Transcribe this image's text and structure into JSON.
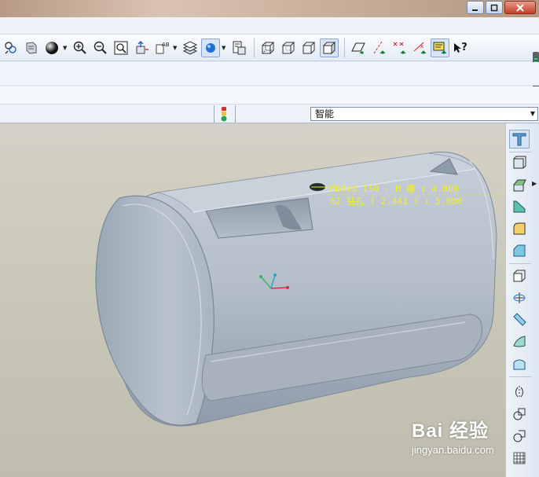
{
  "window": {
    "controls": [
      "minimize",
      "restore",
      "close"
    ]
  },
  "toolbar": {
    "buttons": [
      {
        "name": "layer-icon"
      },
      {
        "name": "saved-view-icon"
      },
      {
        "name": "sphere-shading-icon"
      },
      {
        "name": "zoom-in-icon"
      },
      {
        "name": "zoom-out-icon"
      },
      {
        "name": "refit-icon"
      },
      {
        "name": "reorient-icon"
      },
      {
        "name": "named-views-icon"
      },
      {
        "name": "layers-icon"
      },
      {
        "name": "appearance-icon",
        "active": true
      },
      {
        "name": "model-tree-icon"
      },
      {
        "name": "wireframe-icon"
      },
      {
        "name": "hidden-line-icon"
      },
      {
        "name": "no-hidden-icon"
      },
      {
        "name": "shading-icon",
        "active": true
      },
      {
        "name": "datum-plane-display-icon"
      },
      {
        "name": "datum-axis-display-icon"
      },
      {
        "name": "point-display-icon"
      },
      {
        "name": "csys-display-icon"
      },
      {
        "name": "annotation-display-icon",
        "active": true
      }
    ],
    "help_label": "?"
  },
  "statusbar": {
    "filter_value": "智能"
  },
  "annotation": {
    "line1": "M68x6 ISO - H 螺 ↧ 4.000",
    "line2": "62 钻孔 ( 2.441 ) ↧ 5.000"
  },
  "watermark": {
    "brand": "Bai 经验",
    "url": "jingyan.baidu.com"
  },
  "colors": {
    "viewport_bg": "#cbc9ba",
    "model_body": "#aebac6",
    "annotation_text": "#f2ef22",
    "toolbar_bg": "#eef2f8"
  }
}
